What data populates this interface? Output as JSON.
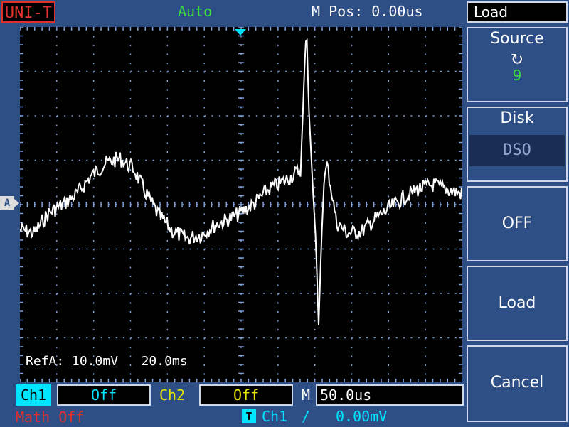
{
  "header": {
    "brand": "UNI-T",
    "trigger_mode": "Auto",
    "m_pos": "M Pos: 0.00us"
  },
  "screen": {
    "ref_info": "RefA: 10.0mV   20.0ms",
    "ref_marker": "A",
    "waveform_color": "#ffffff",
    "grid_color": "#7fa0d8"
  },
  "bottom": {
    "ch1_label": "Ch1",
    "ch1_value": "Off",
    "ch2_label": "Ch2",
    "ch2_value": "Off",
    "m_label": "M",
    "m_value": "50.0us",
    "math": "Math Off",
    "trigger_badge": "T",
    "trigger_source": "Ch1",
    "trigger_slope": "/",
    "trigger_level": "0.00mV"
  },
  "menu": {
    "title": "Load",
    "source_label": "Source",
    "source_icon": "refresh-icon",
    "source_value": "9",
    "disk_label": "Disk",
    "disk_value": "DSO",
    "off_button": "OFF",
    "load_button": "Load",
    "cancel_button": "Cancel"
  }
}
